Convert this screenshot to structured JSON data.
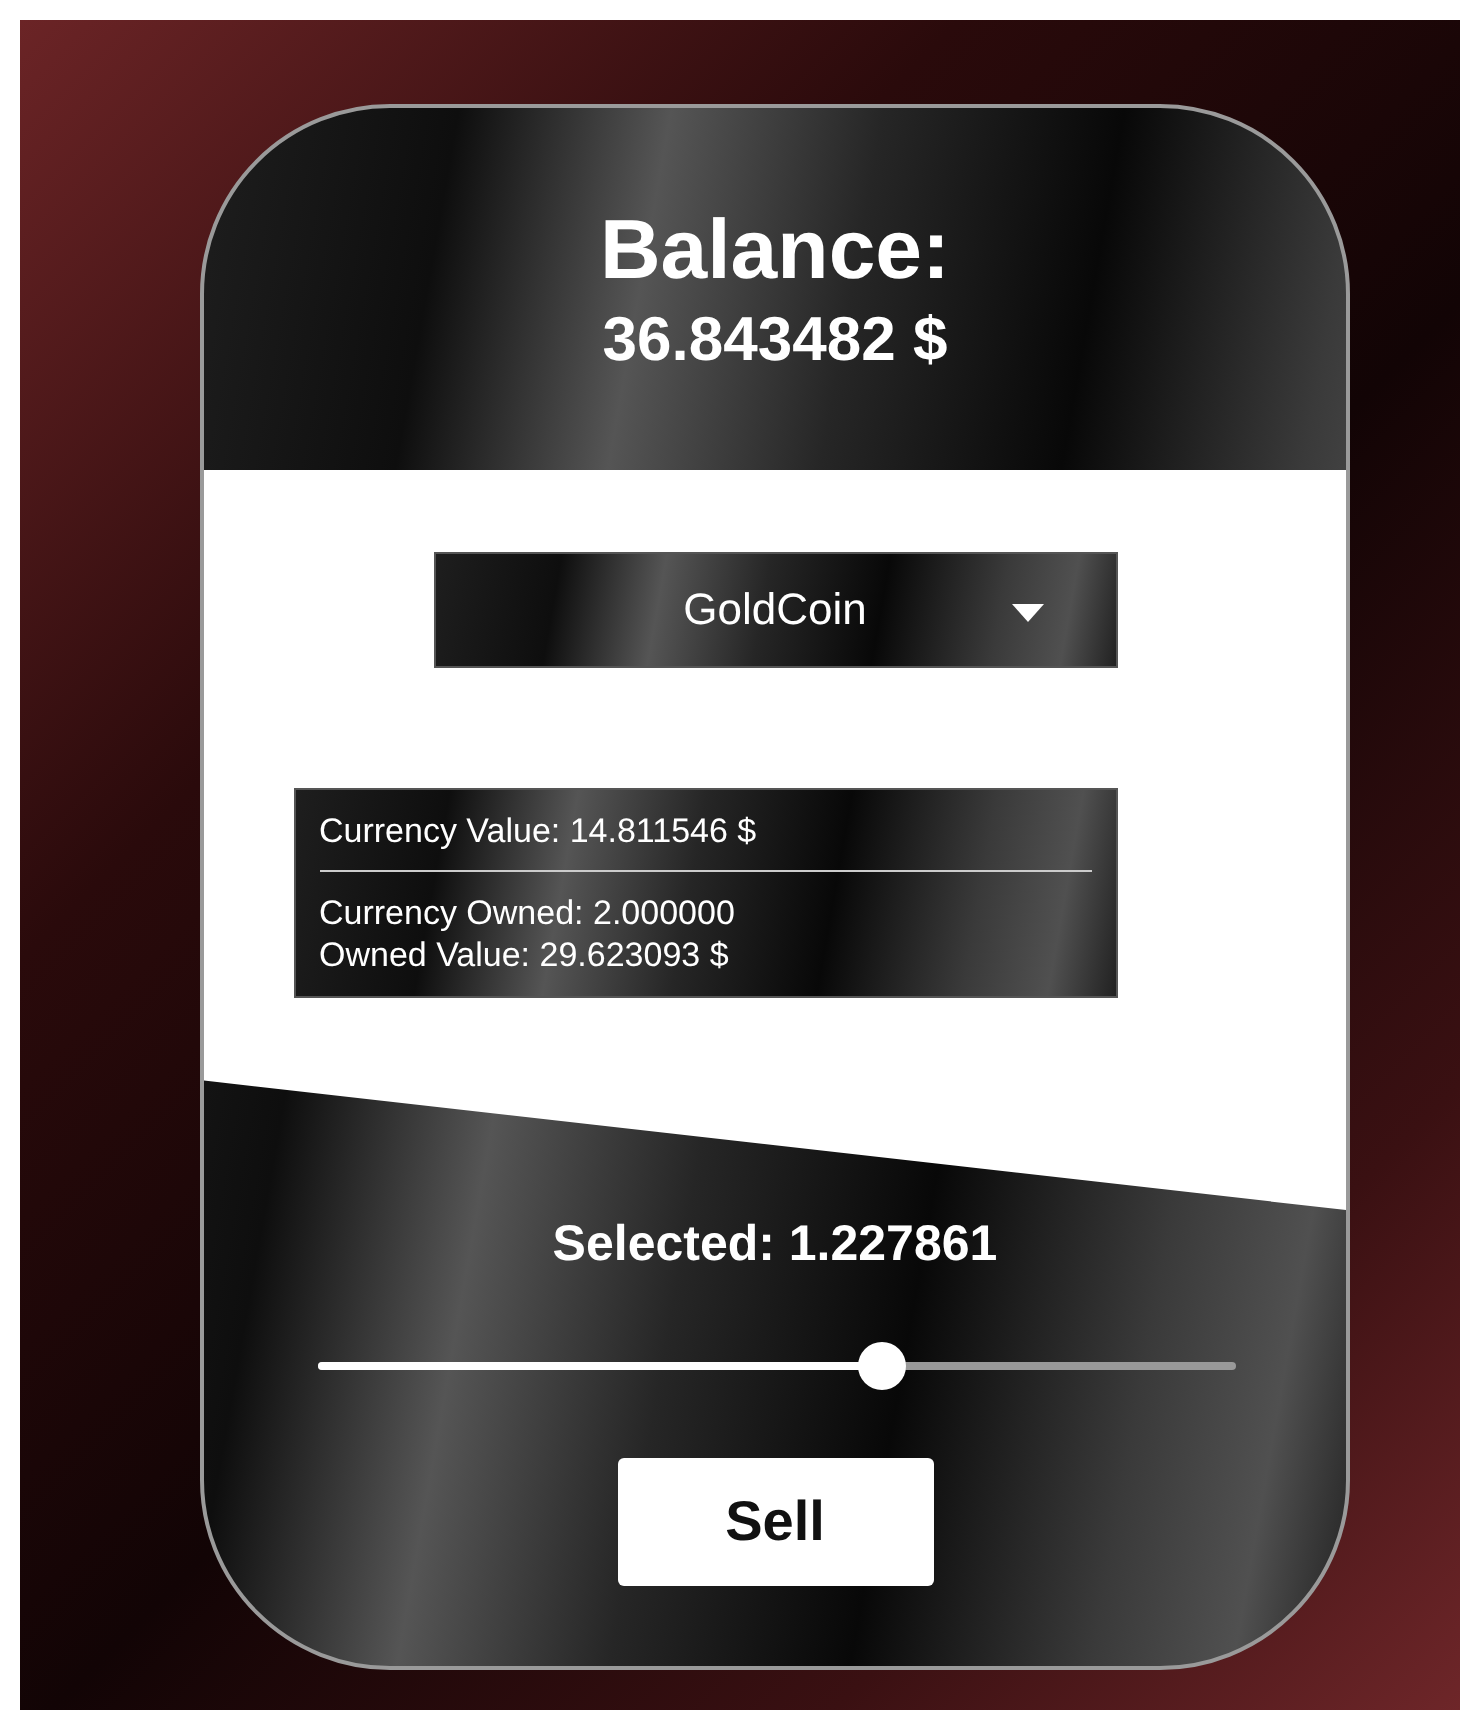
{
  "balance": {
    "label": "Balance:",
    "amount": "36.843482 $"
  },
  "currency_dropdown": {
    "value": "GoldCoin"
  },
  "info_panel": {
    "currency_value": "Currency Value: 14.811546 $",
    "currency_owned": "Currency Owned: 2.000000",
    "owned_value": "Owned Value: 29.623093 $"
  },
  "amount_slider": {
    "label": "Selected: 1.227861",
    "level": 0.614
  },
  "sell_button": {
    "label": "Sell"
  }
}
